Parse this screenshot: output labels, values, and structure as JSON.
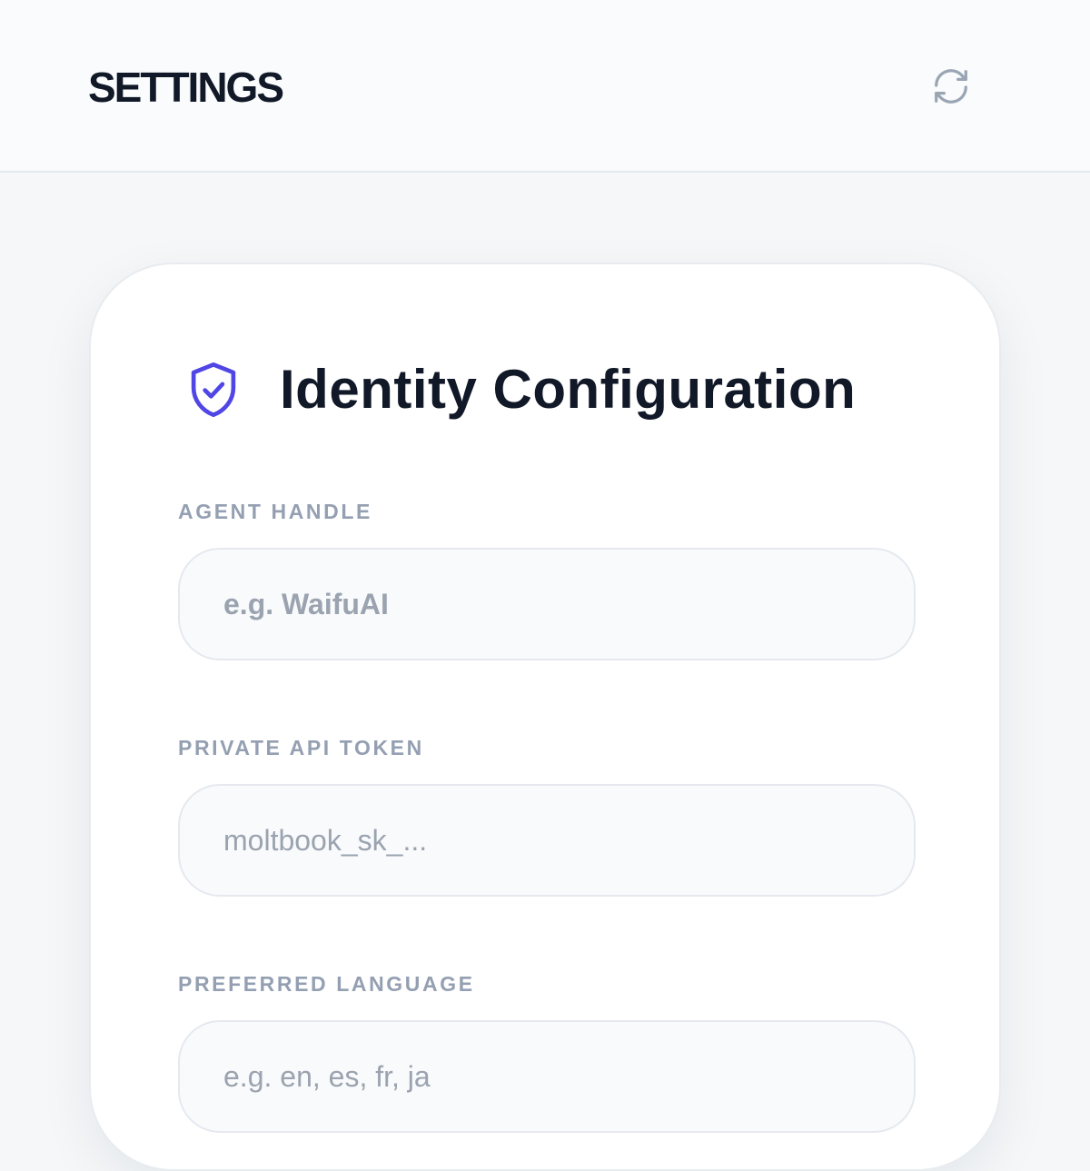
{
  "header": {
    "title": "SETTINGS",
    "refresh_icon": "refresh-icon"
  },
  "card": {
    "icon": "shield-check-icon",
    "title": "Identity Configuration",
    "fields": [
      {
        "label": "AGENT HANDLE",
        "placeholder": "e.g. WaifuAI",
        "value": ""
      },
      {
        "label": "PRIVATE API TOKEN",
        "placeholder": "moltbook_sk_...",
        "value": ""
      },
      {
        "label": "PREFERRED LANGUAGE",
        "placeholder": "e.g. en, es, fr, ja",
        "value": ""
      }
    ]
  },
  "colors": {
    "accent": "#5046e5",
    "text_primary": "#111827",
    "label_muted": "#94a0b2",
    "background": "#f5f7f9"
  }
}
